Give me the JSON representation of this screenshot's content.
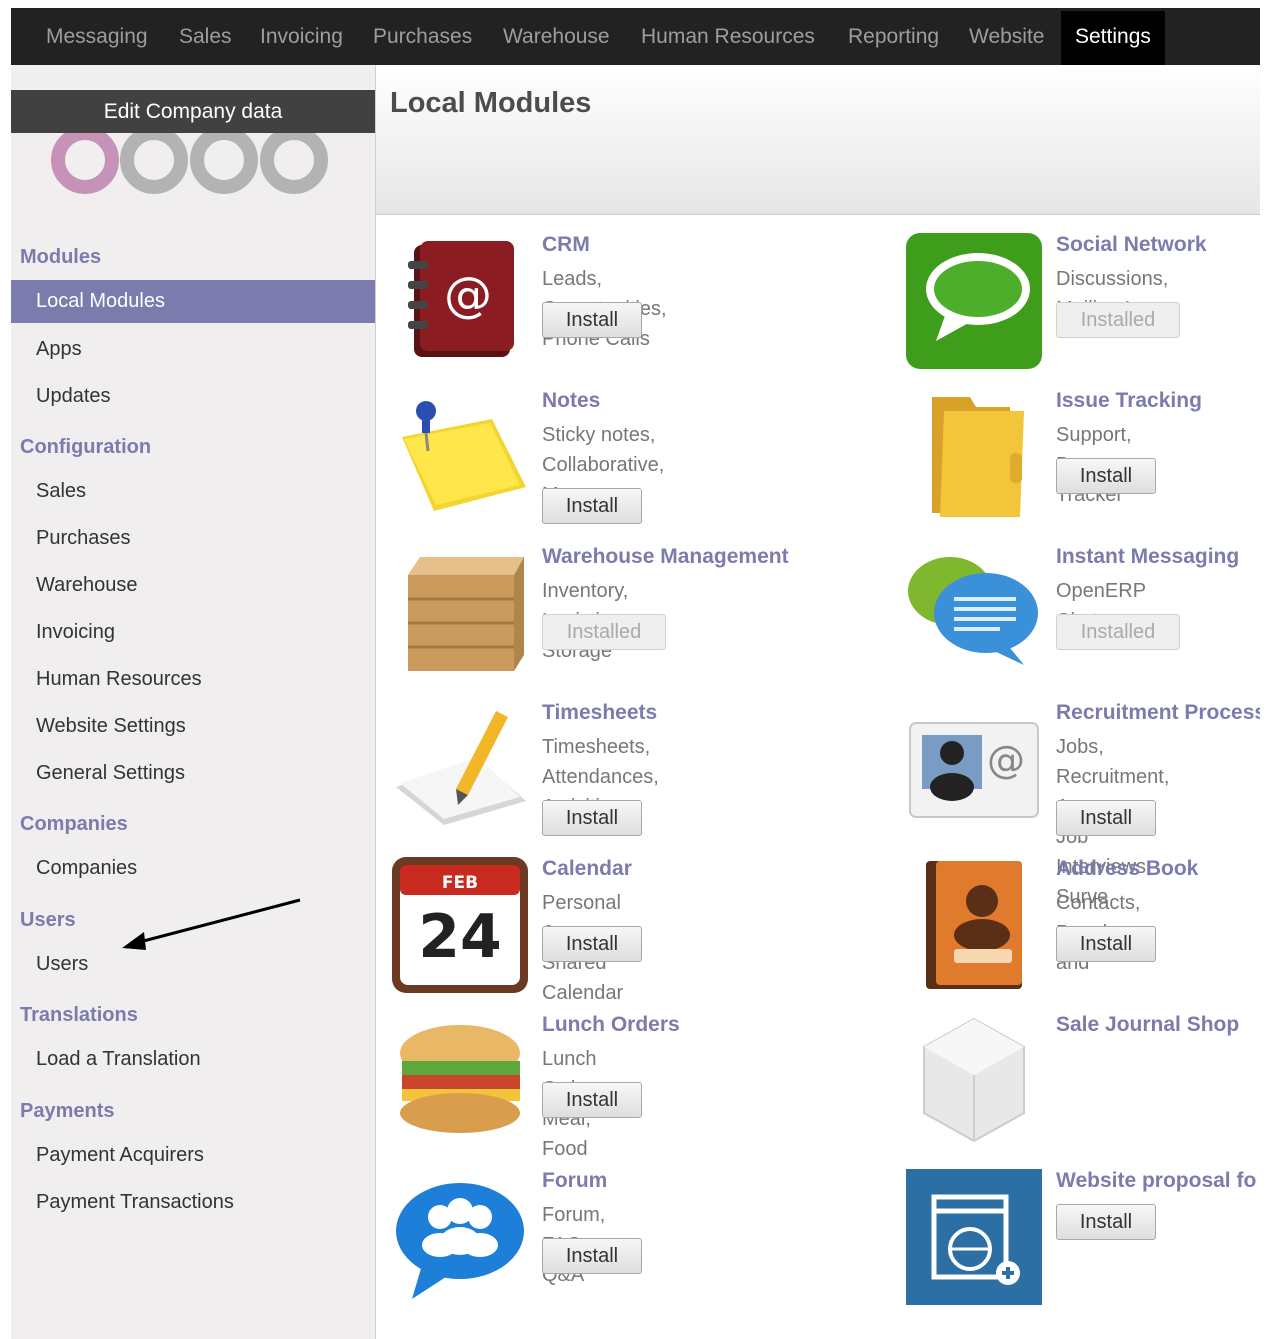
{
  "topnav": {
    "items": [
      "Messaging",
      "Sales",
      "Invoicing",
      "Purchases",
      "Warehouse",
      "Human Resources",
      "Reporting",
      "Website",
      "Settings"
    ],
    "active": "Settings"
  },
  "sidebar": {
    "edit_company": "Edit Company data",
    "logo_text": "odoo",
    "sections": [
      {
        "title": "Modules",
        "items": [
          "Local Modules",
          "Apps",
          "Updates"
        ]
      },
      {
        "title": "Configuration",
        "items": [
          "Sales",
          "Purchases",
          "Warehouse",
          "Invoicing",
          "Human Resources",
          "Website Settings",
          "General Settings"
        ]
      },
      {
        "title": "Companies",
        "items": [
          "Companies"
        ]
      },
      {
        "title": "Users",
        "items": [
          "Users"
        ]
      },
      {
        "title": "Translations",
        "items": [
          "Load a Translation"
        ]
      },
      {
        "title": "Payments",
        "items": [
          "Payment Acquirers",
          "Payment Transactions"
        ]
      }
    ],
    "active_item": "Local Modules"
  },
  "main": {
    "title": "Local Modules",
    "modules": [
      {
        "name": "CRM",
        "summary": "Leads, Opportunities, Phone Calls",
        "button": "Install",
        "icon": "address-book-at-icon"
      },
      {
        "name": "Social Network",
        "summary": "Discussions, Mailing L",
        "button": "Installed",
        "icon": "speech-bubble-green-icon"
      },
      {
        "name": "Notes",
        "summary": "Sticky notes, Collaborative,\nMemos",
        "button": "Install",
        "icon": "sticky-note-pin-icon"
      },
      {
        "name": "Issue Tracking",
        "summary": "Support, Bug Tracker",
        "button": "Install",
        "icon": "folder-icon"
      },
      {
        "name": "Warehouse Management",
        "summary": "Inventory, Logistic, Storage",
        "button": "Installed",
        "icon": "wooden-crate-icon"
      },
      {
        "name": "Instant Messaging",
        "summary": "OpenERP Chat",
        "button": "Installed",
        "icon": "chat-bubbles-icon"
      },
      {
        "name": "Timesheets",
        "summary": "Timesheets, Attendances,\nActivities",
        "button": "Install",
        "icon": "pencil-paper-icon"
      },
      {
        "name": "Recruitment Process",
        "summary": "Jobs, Recruitment, Ap\nJob Interviews, Surve",
        "button": "Install",
        "icon": "contact-card-icon"
      },
      {
        "name": "Calendar",
        "summary": "Personal & Shared Calendar",
        "button": "Install",
        "icon": "calendar-icon",
        "cal_month": "FEB",
        "cal_day": "24"
      },
      {
        "name": "Address Book",
        "summary": "Contacts, People and",
        "button": "Install",
        "icon": "address-book-person-icon"
      },
      {
        "name": "Lunch Orders",
        "summary": "Lunch Order, Meal, Food",
        "button": "Install",
        "icon": "sandwich-icon"
      },
      {
        "name": "Sale Journal Shop",
        "summary": "",
        "button": "",
        "icon": "empty-box-icon"
      },
      {
        "name": "Forum",
        "summary": "Forum, FAQ, Q&A",
        "button": "Install",
        "icon": "forum-people-icon"
      },
      {
        "name": "Website proposal fo",
        "summary": "",
        "button": "Install",
        "icon": "website-add-icon"
      }
    ]
  }
}
